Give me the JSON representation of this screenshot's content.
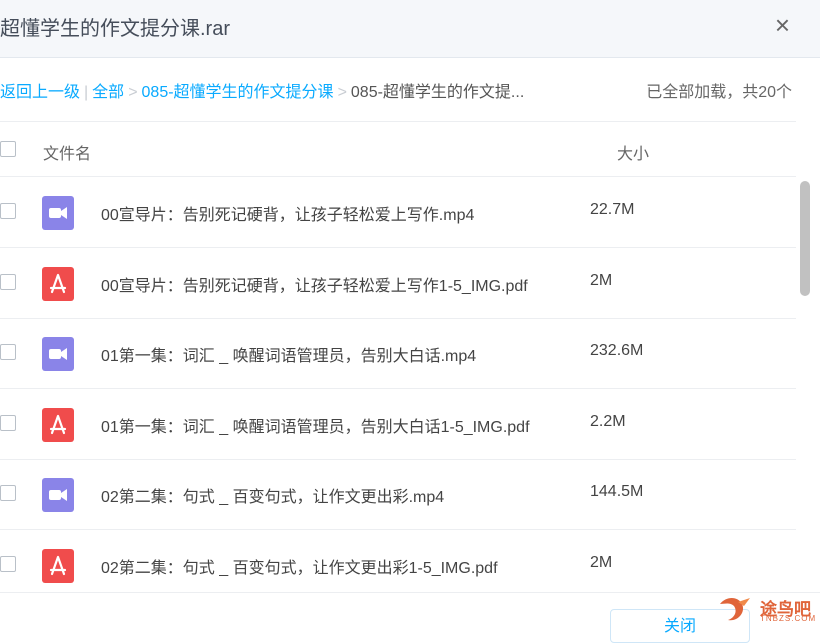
{
  "dialog": {
    "title": "超懂学生的作文提分课.rar",
    "close_glyph": "×"
  },
  "breadcrumb": {
    "back": "返回上一级",
    "pipe": "|",
    "all": "全部",
    "arrow": ">",
    "level1": "085-超懂学生的作文提分课",
    "current": "085-超懂学生的作文提...",
    "status": "已全部加载，共20个"
  },
  "table": {
    "col_name": "文件名",
    "col_size": "大小",
    "rows": [
      {
        "type": "video",
        "name": "00宣导片：告别死记硬背，让孩子轻松爱上写作.mp4",
        "size": "22.7M"
      },
      {
        "type": "pdf",
        "name": "00宣导片：告别死记硬背，让孩子轻松爱上写作1-5_IMG.pdf",
        "size": "2M"
      },
      {
        "type": "video",
        "name": "01第一集：词汇 _ 唤醒词语管理员，告别大白话.mp4",
        "size": "232.6M"
      },
      {
        "type": "pdf",
        "name": "01第一集：词汇 _ 唤醒词语管理员，告别大白话1-5_IMG.pdf",
        "size": "2.2M"
      },
      {
        "type": "video",
        "name": "02第二集：句式 _ 百变句式，让作文更出彩.mp4",
        "size": "144.5M"
      },
      {
        "type": "pdf",
        "name": "02第二集：句式 _ 百变句式，让作文更出彩1-5_IMG.pdf",
        "size": "2M"
      }
    ]
  },
  "footer": {
    "close_button": "关闭"
  },
  "watermark": {
    "text": "途鸟吧",
    "sub": "TNBZS.COM"
  },
  "colors": {
    "link": "#09aaff",
    "video_icon": "#8a84e8",
    "pdf_icon": "#f04c4c",
    "watermark": "#e0653a"
  }
}
